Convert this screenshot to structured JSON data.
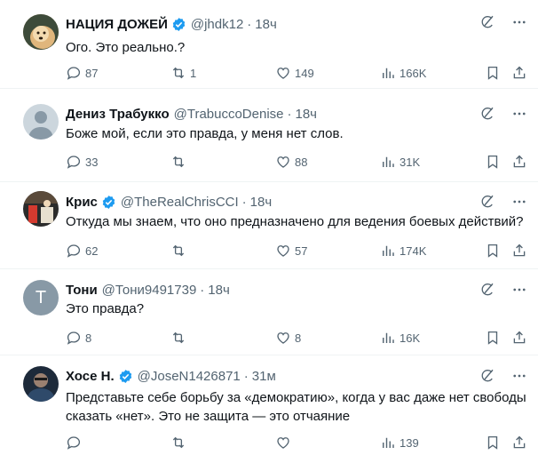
{
  "posts": [
    {
      "name": "НАЦИЯ ДОЖЕЙ",
      "verified": true,
      "handle": "@jhdk12",
      "time": "18ч",
      "text": "Ого. Это реально.?",
      "replies": "87",
      "reposts": "1",
      "likes": "149",
      "views": "166K",
      "avatar": "doge-avatar"
    },
    {
      "name": "Дениз Трабукко",
      "verified": false,
      "handle": "@TrabuccoDenise",
      "time": "18ч",
      "text": "Боже мой, если это правда, у меня нет слов.",
      "replies": "33",
      "reposts": "",
      "likes": "88",
      "views": "31K",
      "avatar": "default-avatar"
    },
    {
      "name": "Крис",
      "verified": true,
      "handle": "@TheRealChrisCCI",
      "time": "18ч",
      "text": "Откуда мы знаем, что оно предназначено для ведения боевых действий?",
      "replies": "62",
      "reposts": "",
      "likes": "57",
      "views": "174K",
      "avatar": "photo-avatar"
    },
    {
      "name": "Тони",
      "verified": false,
      "handle": "@Тони9491739",
      "time": "18ч",
      "text": "Это правда?",
      "replies": "8",
      "reposts": "",
      "likes": "8",
      "views": "16K",
      "avatar": "letter-avatar",
      "avatar_letter": "T"
    },
    {
      "name": "Хосе Н.",
      "verified": true,
      "handle": "@JoseN1426871",
      "time": "31м",
      "text": "Представьте себе борьбу за «демократию», когда у вас даже нет свободы сказать «нет». Это не защита — это отчаяние",
      "replies": "",
      "reposts": "",
      "likes": "",
      "views": "139",
      "avatar": "photo-avatar-dark"
    }
  ],
  "colors": {
    "text": "#0f1419",
    "secondary": "#536471",
    "verified": "#1d9bf0",
    "divider": "#eff3f4"
  }
}
